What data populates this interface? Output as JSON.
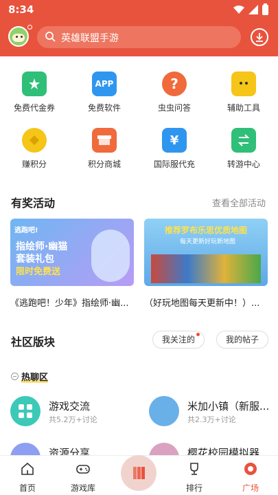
{
  "status_bar": {
    "time": "8:34"
  },
  "header": {
    "search_placeholder": "英雄联盟手游"
  },
  "grid": [
    {
      "label": "免费代金券",
      "icon": "voucher-icon",
      "color": "#2fbf78"
    },
    {
      "label": "免费软件",
      "icon": "app-icon",
      "color": "#2f96f0",
      "text": "APP"
    },
    {
      "label": "虫虫问答",
      "icon": "question-icon",
      "color": "#f06a3c",
      "text": "?"
    },
    {
      "label": "辅助工具",
      "icon": "bee-icon",
      "color": "#f5c518"
    },
    {
      "label": "赚积分",
      "icon": "coin-icon",
      "color": "#f5c518"
    },
    {
      "label": "积分商城",
      "icon": "shop-icon",
      "color": "#f06a3c"
    },
    {
      "label": "国际服代充",
      "icon": "yuan-icon",
      "color": "#2f96f0",
      "text": "¥"
    },
    {
      "label": "转游中心",
      "icon": "transfer-icon",
      "color": "#2fbf78"
    }
  ],
  "activities": {
    "title": "有奖活动",
    "see_all": "查看全部活动",
    "items": [
      {
        "caption": "《逃跑吧！少年》指绘师·幽...",
        "line1": "指绘师·幽猫",
        "line2": "套装礼包",
        "line3": "限时免费送",
        "logo": "逃跑吧!"
      },
      {
        "caption": "（好玩地图每天更新中！）...",
        "line1": "推荐罗布乐思优质地图",
        "line2": "每天更新好玩新地图"
      }
    ]
  },
  "community": {
    "title": "社区版块",
    "tab_following": "我关注的",
    "tab_posts": "我的帖子",
    "hot_label": "热聊区",
    "items": [
      {
        "name": "游戏交流",
        "meta": "共5.2万+讨论",
        "color": "#3cc9b8"
      },
      {
        "name": "米加小镇（新服...",
        "meta": "共2.3万+讨论",
        "color": "#6ab0e8"
      },
      {
        "name": "资源分享",
        "meta": "",
        "color": "#8c9ff0"
      },
      {
        "name": "樱花校园模拟器",
        "meta": "",
        "color": "#d9a2c0"
      }
    ]
  },
  "bottom_nav": [
    {
      "label": "首页",
      "icon": "home-icon",
      "active": false
    },
    {
      "label": "游戏库",
      "icon": "gamepad-icon",
      "active": false
    },
    {
      "label": "排行",
      "icon": "trophy-icon",
      "active": false
    },
    {
      "label": "广场",
      "icon": "plaza-icon",
      "active": true
    }
  ],
  "colors": {
    "brand": "#e8533d",
    "active_tab": "#e8533d"
  }
}
